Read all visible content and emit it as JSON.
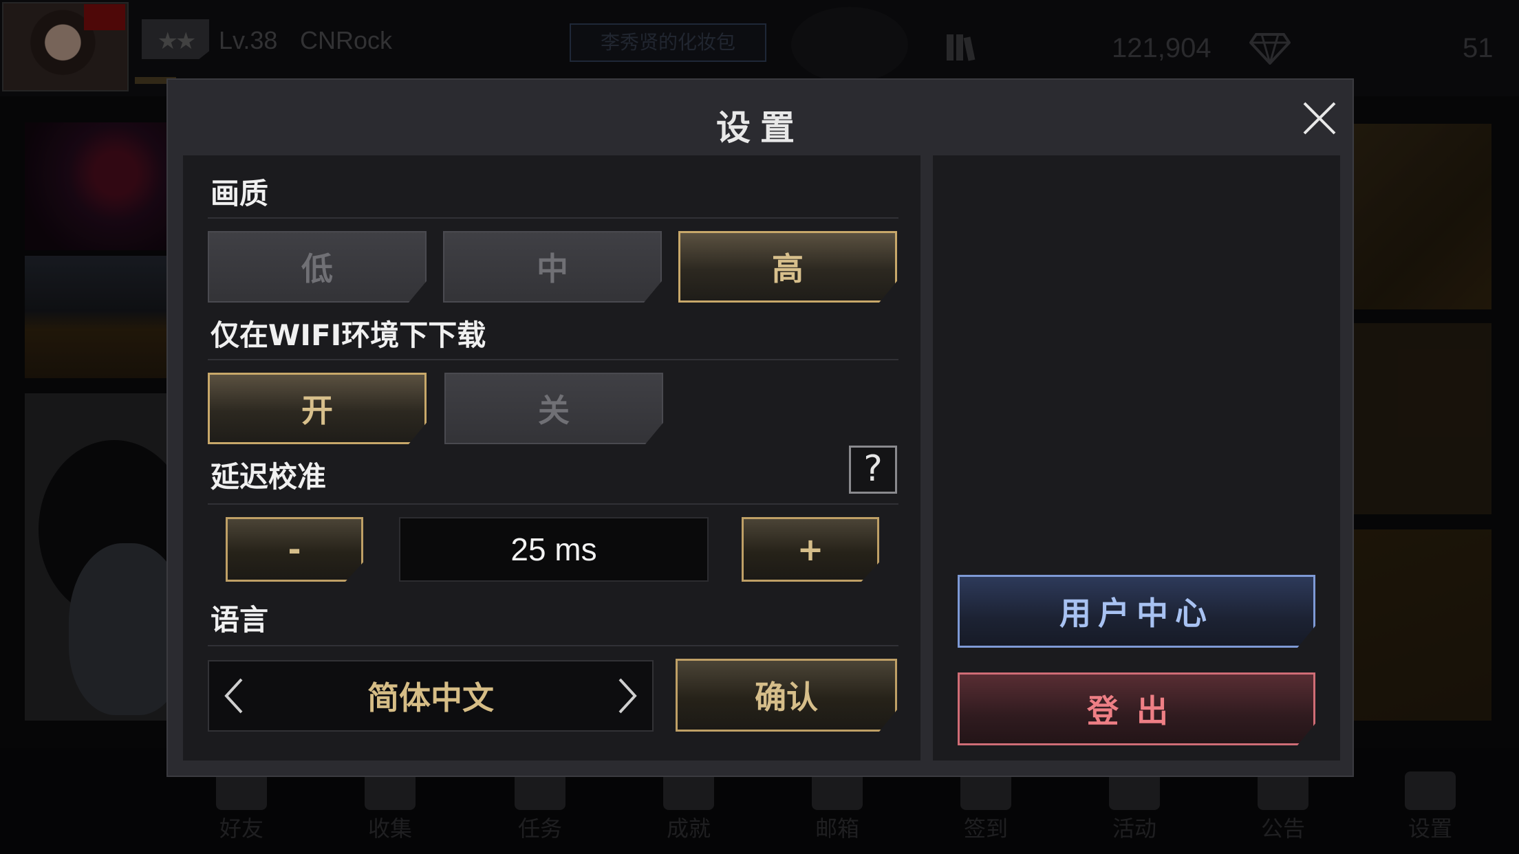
{
  "player": {
    "level": "Lv.38",
    "username": "CNRock",
    "song_box": "李秀贤的化妆包",
    "coins": "121,904",
    "gems": "51"
  },
  "bottom_nav": [
    "好友",
    "收集",
    "任务",
    "成就",
    "邮箱",
    "签到",
    "活动",
    "公告",
    "设置"
  ],
  "dialog": {
    "title": "设置",
    "quality": {
      "label": "画质",
      "options": [
        "低",
        "中",
        "高"
      ],
      "selected": "高"
    },
    "wifi_download": {
      "label": "仅在WIFI环境下下载",
      "options": [
        "开",
        "关"
      ],
      "selected": "开"
    },
    "latency": {
      "label": "延迟校准",
      "help": "?",
      "decrement": "-",
      "value": "25 ms",
      "increment": "+"
    },
    "language": {
      "label": "语言",
      "value": "简体中文",
      "confirm": "确认"
    },
    "user_center": "用户中心",
    "logout": "登出"
  },
  "colors": {
    "gold_accent": "#c8a86a",
    "blue_accent": "#7e9ad6",
    "red_accent": "#d06d76"
  }
}
